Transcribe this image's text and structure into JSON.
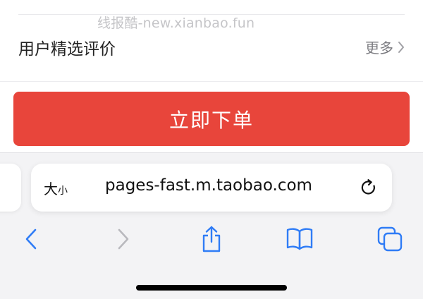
{
  "watermark": "线报酷-new.xianbao.fun",
  "reviews": {
    "title": "用户精选评价",
    "more_label": "更多"
  },
  "buy_button_label": "立即下单",
  "browser": {
    "text_size_large": "大",
    "text_size_small": "小",
    "url": "pages-fast.m.taobao.com"
  },
  "icons": [
    "chevron-right-icon",
    "reload-icon",
    "back-icon",
    "forward-icon",
    "share-icon",
    "bookmarks-icon",
    "tabs-icon"
  ],
  "colors": {
    "buy_button": "#e8453b",
    "toolbar_accent": "#2f7cf6",
    "toolbar_disabled": "#b9b9be"
  }
}
